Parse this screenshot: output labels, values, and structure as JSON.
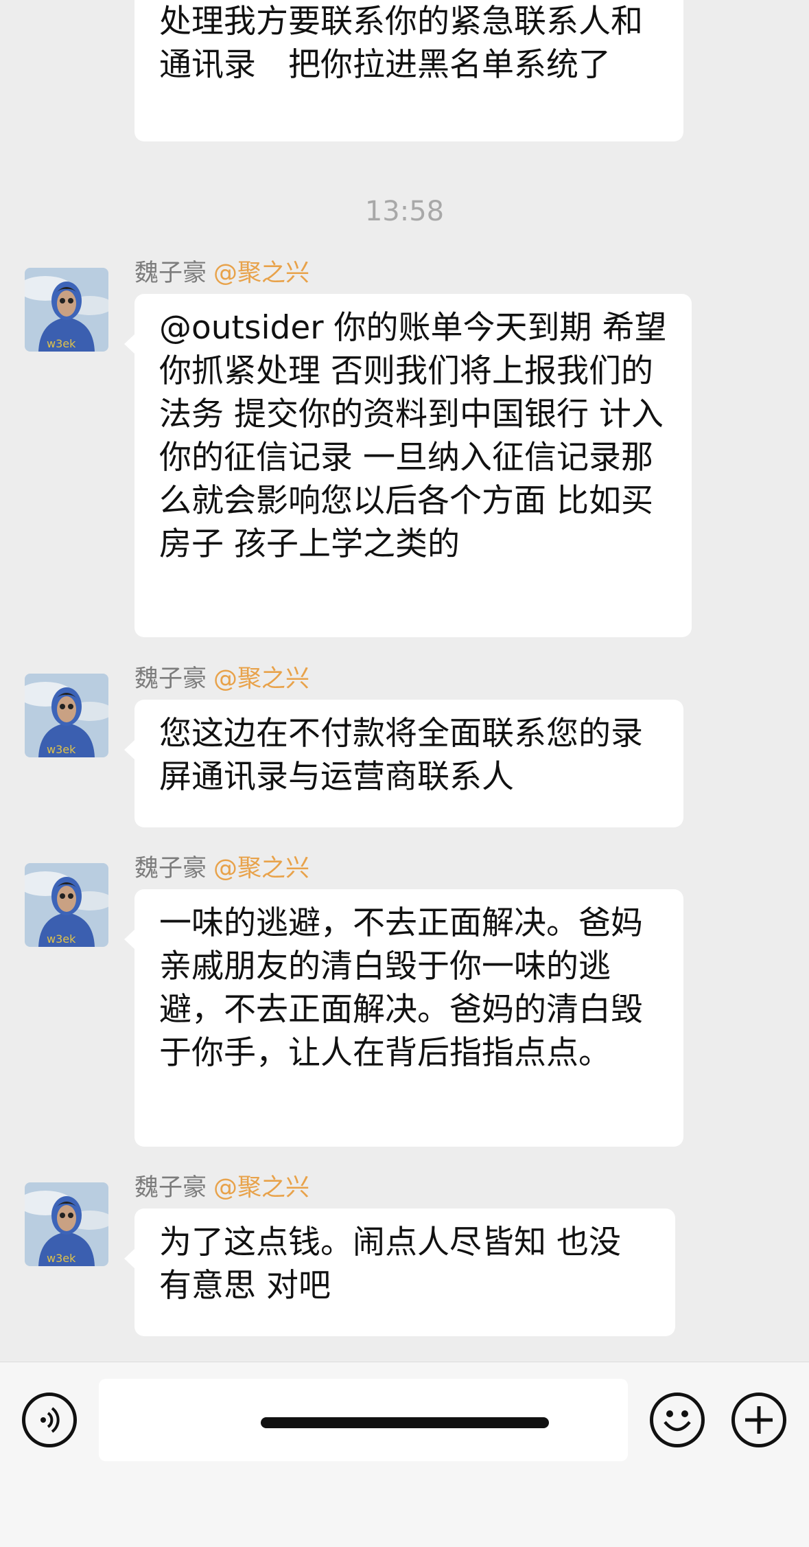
{
  "messages": [
    {
      "text": "处理我方要联系你的紧急联系人和通讯录　把你拉进黑名单系统了"
    }
  ],
  "timestamp": "13:58",
  "sender_messages": [
    {
      "sender": "魏子豪",
      "mention": "@聚之兴",
      "text": "@outsider 你的账单今天到期  希望你抓紧处理  否则我们将上报我们的法务  提交你的资料到中国银行  计入你的征信记录  一旦纳入征信记录那么就会影响您以后各个方面   比如买房子 孩子上学之类的"
    },
    {
      "sender": "魏子豪",
      "mention": "@聚之兴",
      "text": "您这边在不付款将全面联系您的录屏通讯录与运营商联系人"
    },
    {
      "sender": "魏子豪",
      "mention": "@聚之兴",
      "text": "一味的逃避，不去正面解决。爸妈亲戚朋友的清白毁于你一味的逃避，不去正面解决。爸妈的清白毁于你手，让人在背后指指点点。"
    },
    {
      "sender": "魏子豪",
      "mention": "@聚之兴",
      "text": "为了这点钱。闹点人尽皆知   也没有意思 对吧"
    }
  ],
  "input": {
    "value": "",
    "placeholder": ""
  },
  "icons": {
    "voice": "voice-icon",
    "emoji": "emoji-icon",
    "add": "plus-icon"
  },
  "colors": {
    "mention": "#e8a24a",
    "background": "#ededed",
    "bubble": "#ffffff"
  }
}
